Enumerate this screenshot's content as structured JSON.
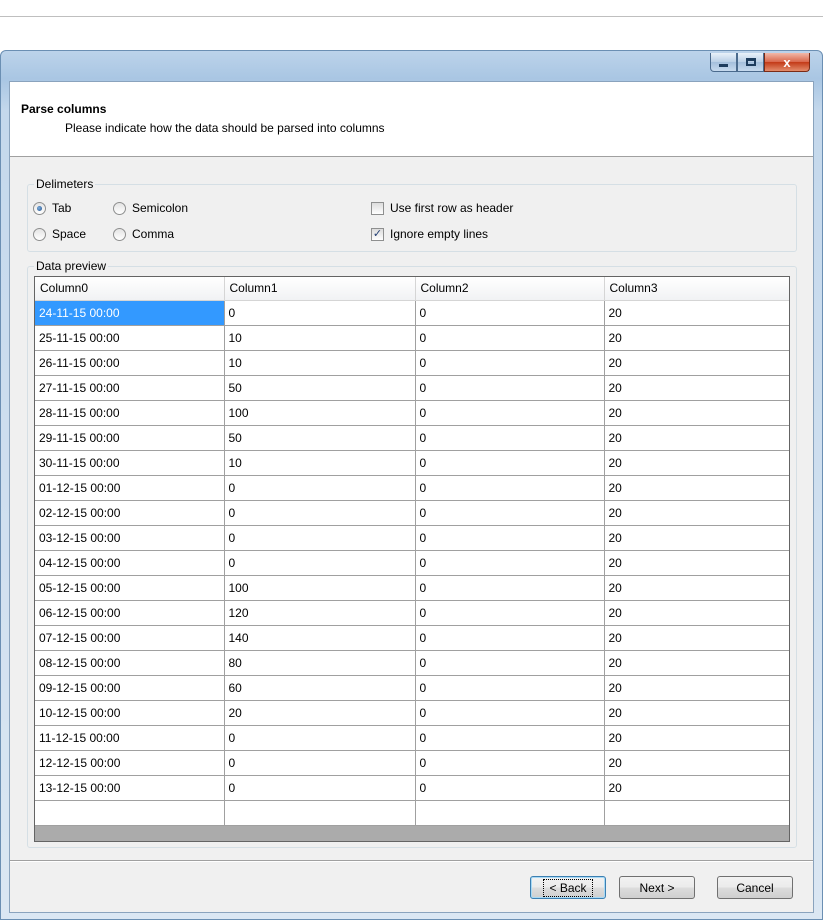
{
  "header": {
    "title": "Parse columns",
    "subtitle": "Please indicate how the data should be parsed into columns"
  },
  "delimiters": {
    "label": "Delimeters",
    "options": [
      {
        "label": "Tab",
        "checked": true
      },
      {
        "label": "Semicolon",
        "checked": false
      },
      {
        "label": "Space",
        "checked": false
      },
      {
        "label": "Comma",
        "checked": false
      }
    ],
    "use_first_row_header": {
      "label": "Use first row as header",
      "checked": false
    },
    "ignore_empty_lines": {
      "label": "Ignore empty lines",
      "checked": true
    }
  },
  "preview": {
    "label": "Data preview",
    "columns": [
      "Column0",
      "Column1",
      "Column2",
      "Column3"
    ],
    "rows": [
      [
        "24-11-15 00:00",
        "0",
        "0",
        "20"
      ],
      [
        "25-11-15 00:00",
        "10",
        "0",
        "20"
      ],
      [
        "26-11-15 00:00",
        "10",
        "0",
        "20"
      ],
      [
        "27-11-15 00:00",
        "50",
        "0",
        "20"
      ],
      [
        "28-11-15 00:00",
        "100",
        "0",
        "20"
      ],
      [
        "29-11-15 00:00",
        "50",
        "0",
        "20"
      ],
      [
        "30-11-15 00:00",
        "10",
        "0",
        "20"
      ],
      [
        "01-12-15 00:00",
        "0",
        "0",
        "20"
      ],
      [
        "02-12-15 00:00",
        "0",
        "0",
        "20"
      ],
      [
        "03-12-15 00:00",
        "0",
        "0",
        "20"
      ],
      [
        "04-12-15 00:00",
        "0",
        "0",
        "20"
      ],
      [
        "05-12-15 00:00",
        "100",
        "0",
        "20"
      ],
      [
        "06-12-15 00:00",
        "120",
        "0",
        "20"
      ],
      [
        "07-12-15 00:00",
        "140",
        "0",
        "20"
      ],
      [
        "08-12-15 00:00",
        "80",
        "0",
        "20"
      ],
      [
        "09-12-15 00:00",
        "60",
        "0",
        "20"
      ],
      [
        "10-12-15 00:00",
        "20",
        "0",
        "20"
      ],
      [
        "11-12-15 00:00",
        "0",
        "0",
        "20"
      ],
      [
        "12-12-15 00:00",
        "0",
        "0",
        "20"
      ],
      [
        "13-12-15 00:00",
        "0",
        "0",
        "20"
      ]
    ]
  },
  "buttons": {
    "back": "< Back",
    "next": "Next >",
    "cancel": "Cancel"
  },
  "window_controls": {
    "minimize_icon": "minimize-icon",
    "maximize_icon": "maximize-icon",
    "close_icon": "close-icon",
    "close_glyph": "x"
  },
  "colors": {
    "selection": "#3399ff",
    "close_button": "#c33a17"
  }
}
